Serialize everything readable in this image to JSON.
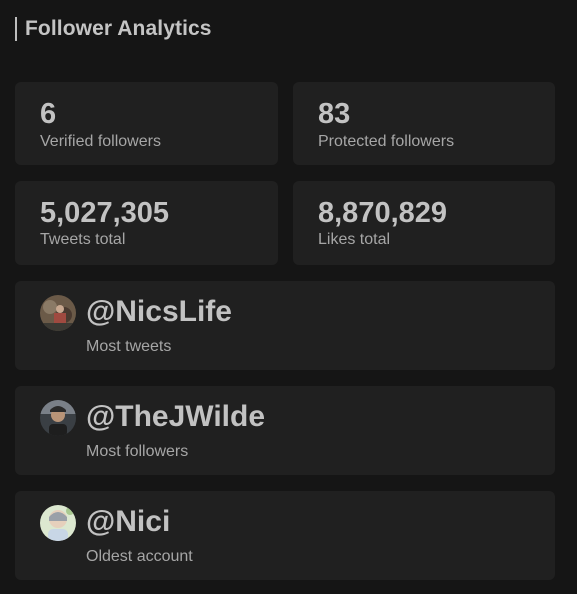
{
  "header": {
    "title": "Follower Analytics"
  },
  "stats": [
    {
      "value": "6",
      "label": "Verified followers"
    },
    {
      "value": "83",
      "label": "Protected followers"
    },
    {
      "value": "5,027,305",
      "label": "Tweets total"
    },
    {
      "value": "8,870,829",
      "label": "Likes total"
    }
  ],
  "users": [
    {
      "handle": "@NicsLife",
      "label": "Most tweets",
      "avatar": "avatar-photo"
    },
    {
      "handle": "@TheJWilde",
      "label": "Most followers",
      "avatar": "avatar-photo"
    },
    {
      "handle": "@Nici",
      "label": "Oldest account",
      "avatar": "avatar-photo"
    }
  ],
  "colors": {
    "background": "#151515",
    "card": "#202020",
    "text_primary": "#c2c2c2",
    "text_secondary": "#a6a6a6"
  }
}
